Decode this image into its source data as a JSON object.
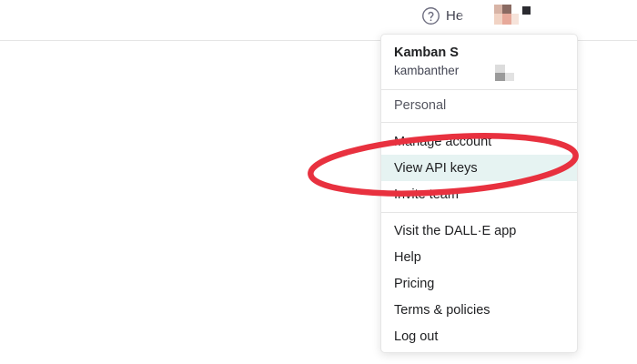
{
  "header": {
    "help_label": "He",
    "icons": {
      "help": "question-circle-icon"
    }
  },
  "menu": {
    "user_name": "Kamban S",
    "user_email": "kambanther",
    "section_label": "Personal",
    "items": [
      {
        "label": "Manage account"
      },
      {
        "label": "View API keys",
        "highlighted": true
      },
      {
        "label": "Invite team"
      }
    ],
    "links": [
      {
        "label": "Visit the DALL·E app"
      },
      {
        "label": "Help"
      },
      {
        "label": "Pricing"
      },
      {
        "label": "Terms & policies"
      },
      {
        "label": "Log out"
      }
    ]
  },
  "colors": {
    "highlight_bg": "#e6f3f2",
    "annotation_red": "#e8313f"
  }
}
